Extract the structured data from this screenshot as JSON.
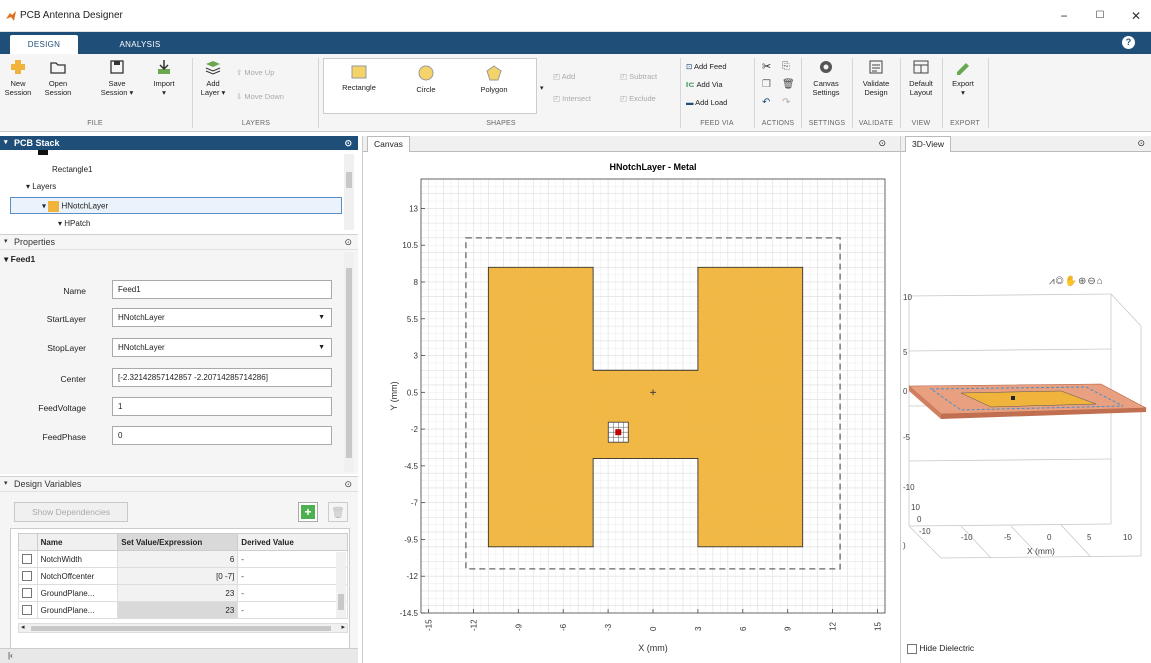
{
  "app": {
    "title": "PCB Antenna Designer"
  },
  "window_controls": {
    "minimize": "−",
    "maximize": "☐",
    "close": "✕"
  },
  "tabs": [
    {
      "label": "DESIGN"
    },
    {
      "label": "ANALYSIS"
    }
  ],
  "help_label": "?",
  "ribbon": {
    "file": {
      "new_session": [
        "New",
        "Session"
      ],
      "open_session": [
        "Open",
        "Session"
      ],
      "save_session": [
        "Save",
        "Session ▾"
      ],
      "import": [
        "Import",
        "▾"
      ],
      "label": "FILE"
    },
    "layers": {
      "add_layer": [
        "Add",
        "Layer ▾"
      ],
      "move_up": "Move Up",
      "move_down": "Move Down",
      "label": "LAYERS"
    },
    "shapes": {
      "items": [
        "Rectangle",
        "Circle",
        "Polygon"
      ],
      "add": "Add",
      "subtract": "Subtract",
      "intersect": "Intersect",
      "exclude": "Exclude",
      "label": "SHAPES"
    },
    "feed_via": {
      "add_feed": "Add Feed",
      "add_via": "Add Via",
      "add_load": "Add Load",
      "label": "FEED VIA"
    },
    "actions": {
      "label": "ACTIONS"
    },
    "settings": {
      "canvas_settings": [
        "Canvas",
        "Settings"
      ],
      "label": "SETTINGS"
    },
    "validate": {
      "validate_design": [
        "Validate",
        "Design"
      ],
      "label": "VALIDATE"
    },
    "view": {
      "default_layout": [
        "Default",
        "Layout"
      ],
      "label": "VIEW"
    },
    "export": {
      "export": [
        "Export",
        "▾"
      ],
      "label": "EXPORT"
    }
  },
  "pcb_stack": {
    "title": "PCB Stack",
    "items": [
      "Rectangle1",
      "Layers",
      "HNotchLayer",
      "HPatch"
    ]
  },
  "properties": {
    "title": "Properties",
    "group": "Feed1",
    "fields": [
      {
        "label": "Name",
        "value": "Feed1"
      },
      {
        "label": "StartLayer",
        "value": "HNotchLayer"
      },
      {
        "label": "StopLayer",
        "value": "HNotchLayer"
      },
      {
        "label": "Center",
        "value": "[-2.32142857142857 -2.20714285714286]"
      },
      {
        "label": "FeedVoltage",
        "value": "1"
      },
      {
        "label": "FeedPhase",
        "value": "0"
      }
    ]
  },
  "design_variables": {
    "title": "Design Variables",
    "show_dependencies": "Show Dependencies",
    "columns": [
      "Name",
      "Set Value/Expression",
      "Derived Value"
    ],
    "rows": [
      {
        "name": "NotchWidth",
        "value": "6",
        "derived": "-"
      },
      {
        "name": "NotchOffcenter",
        "value": "[0 -7]",
        "derived": "-"
      },
      {
        "name": "GroundPlane...",
        "value": "23",
        "derived": "-"
      },
      {
        "name": "GroundPlane...",
        "value": "23",
        "derived": "-"
      }
    ]
  },
  "canvas": {
    "tab": "Canvas",
    "chart_data": {
      "type": "layout",
      "title": "HNotchLayer - Metal",
      "xlabel": "X (mm)",
      "ylabel": "Y (mm)",
      "xticks": [
        -15,
        -12,
        -9,
        -6,
        -3,
        0,
        3,
        6,
        9,
        12,
        15
      ],
      "yticks": [
        13,
        10.5,
        8,
        5.5,
        3,
        0.5,
        -2,
        -4.5,
        -7,
        -9.5,
        -12,
        -14.5
      ],
      "xlim": [
        -15.5,
        15.5
      ],
      "ylim": [
        -14.5,
        15
      ],
      "shape_outline_x": [
        -11,
        -4,
        -4,
        3,
        3,
        10,
        10,
        3,
        3,
        -4,
        -4,
        -11
      ],
      "shape_outline_y": [
        9,
        9,
        2,
        2,
        9,
        9,
        -10,
        -10,
        -4,
        -4,
        -10,
        -10
      ],
      "ground_plane_dashed": {
        "x": [
          -12.5,
          12.5
        ],
        "y": [
          -11.5,
          11
        ]
      },
      "feed_point": [
        -2.32,
        -2.21
      ],
      "center_marker": [
        0,
        0.5
      ],
      "metal_color": "#f0b43c"
    }
  },
  "view3d": {
    "tab": "3D-View",
    "zticks": [
      "10",
      "5",
      "0",
      "-5",
      "-10"
    ],
    "yticks": [
      "10",
      "0",
      "-10"
    ],
    "xticks": [
      "-10",
      "-5",
      "0",
      "5",
      "10"
    ],
    "xlabel": "X (mm)",
    "side_label": ")",
    "hide_dielectric": "Hide Dielectric"
  },
  "colors": {
    "accent": "#1f4e79",
    "metal": "#f0b43c",
    "dielectric": "#e8a080"
  }
}
